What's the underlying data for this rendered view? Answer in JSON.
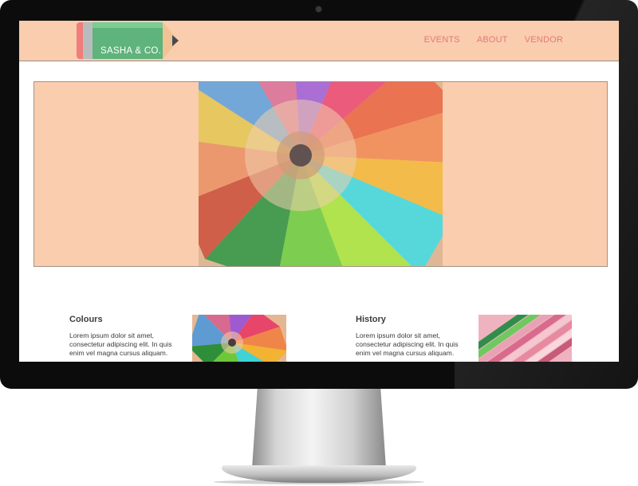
{
  "site": {
    "logo_text": "SASHA & CO.",
    "nav": [
      {
        "label": "EVENTS"
      },
      {
        "label": "ABOUT"
      },
      {
        "label": "VENDOR"
      }
    ]
  },
  "cards": [
    {
      "title": "Colours",
      "text": "Lorem ipsum dolor sit amet, consectetur adipiscing elit. In quis enim vel magna cursus aliquam."
    },
    {
      "title": "History",
      "text": "Lorem ipsum dolor sit amet, consectetur adipiscing elit. In quis enim vel magna cursus aliquam."
    }
  ],
  "colors": {
    "header_bg": "#f9cdae",
    "nav_text": "#e87777",
    "logo_green": "#5fb37c",
    "bezel": "#0c0c0c"
  },
  "icons": {
    "logo": "pencil-logo-icon",
    "webcam": "webcam-icon"
  }
}
